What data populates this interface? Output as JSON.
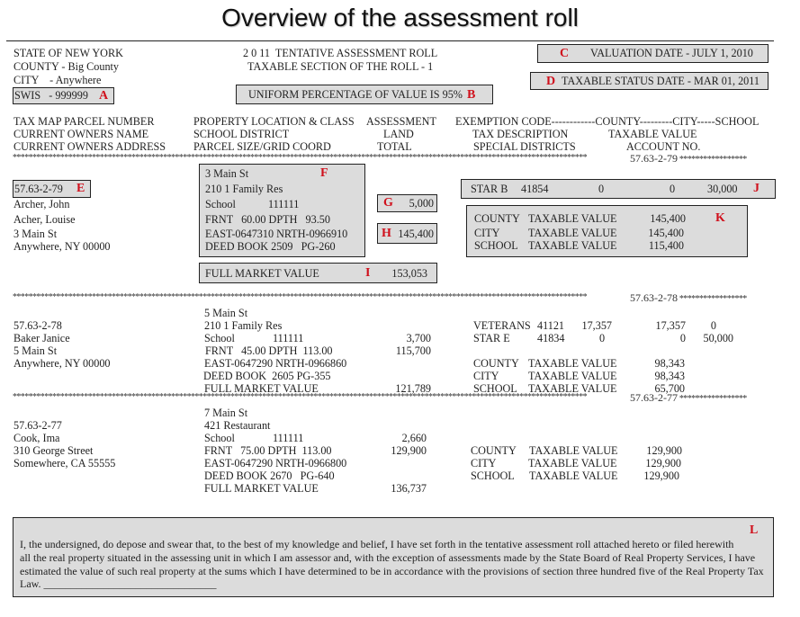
{
  "title": "Overview of the assessment roll",
  "header": {
    "state": "STATE OF NEW YORK",
    "county": "COUNTY - Big County",
    "city": "CITY    - Anywhere",
    "swis": "SWIS   - 999999",
    "roll_title": "2 0 11  TENTATIVE ASSESSMENT ROLL",
    "roll_section": "TAXABLE SECTION OF THE ROLL - 1",
    "uniform_percentage": "UNIFORM PERCENTAGE OF VALUE IS 95%",
    "valuation_date": "VALUATION DATE - JULY 1, 2010",
    "taxable_status_date": "TAXABLE STATUS DATE - MAR 01, 2011"
  },
  "labels": {
    "A": "A",
    "B": "B",
    "C": "C",
    "D": "D",
    "E": "E",
    "F": "F",
    "G": "G",
    "H": "H",
    "I": "I",
    "J": "J",
    "K": "K",
    "L": "L"
  },
  "columns": {
    "col1": [
      "TAX MAP PARCEL NUMBER",
      "CURRENT OWNERS NAME",
      "CURRENT OWNERS ADDRESS"
    ],
    "col2": [
      "PROPERTY LOCATION & CLASS",
      "SCHOOL DISTRICT",
      "PARCEL SIZE/GRID COORD"
    ],
    "col3": [
      "ASSESSMENT",
      "LAND",
      "TOTAL"
    ],
    "col4": [
      "EXEMPTION CODE------------COUNTY---------CITY-----SCHOOL",
      "TAX DESCRIPTION",
      "SPECIAL DISTRICTS"
    ],
    "col5": [
      "",
      "TAXABLE VALUE",
      "ACCOUNT NO."
    ]
  },
  "separators": {
    "stars_left": "*************************************************************************************************************************************************",
    "stars_right": "*****************"
  },
  "parcels": [
    {
      "parcel_number": "57.63-2-79",
      "owners": [
        "Archer, John",
        "Acher, Louise"
      ],
      "address": [
        "3 Main St",
        "Anywhere, NY 00000"
      ],
      "location": "3 Main St",
      "class": "210 1 Family Res",
      "school_label": "School",
      "school_code": "111111",
      "frontage": "FRNT   60.00 DPTH   93.50",
      "grid": "EAST-0647310 NRTH-0966910",
      "deed": "DEED BOOK 2509   PG-260",
      "full_market_label": "FULL MARKET VALUE",
      "land": "5,000",
      "total": "145,400",
      "full_market_value": "153,053",
      "exemptions": [
        {
          "name": "STAR B",
          "code": "41854",
          "county": "0",
          "city": "0",
          "school": "30,000"
        }
      ],
      "taxable": [
        {
          "jurisdiction": "COUNTY",
          "desc": "TAXABLE VALUE",
          "value": "145,400"
        },
        {
          "jurisdiction": "CITY",
          "desc": "TAXABLE VALUE",
          "value": "145,400"
        },
        {
          "jurisdiction": "SCHOOL",
          "desc": "TAXABLE VALUE",
          "value": "115,400"
        }
      ]
    },
    {
      "parcel_number": "57.63-2-78",
      "owners": [
        "Baker Janice"
      ],
      "address": [
        "5 Main St",
        "Anywhere, NY 00000"
      ],
      "location": "5 Main St",
      "class": "210 1 Family Res",
      "school_label": "School",
      "school_code": "111111",
      "frontage": "FRNT   45.00 DPTH  113.00",
      "grid": "EAST-0647290 NRTH-0966860",
      "deed": "DEED BOOK  2605 PG-355",
      "full_market_label": "FULL MARKET VALUE",
      "land": "3,700",
      "total": "115,700",
      "full_market_value": "121,789",
      "exemptions": [
        {
          "name": "VETERANS",
          "code": "41121",
          "county": "17,357",
          "city": "17,357",
          "school": "0"
        },
        {
          "name": "STAR E",
          "code": "41834",
          "county": "0",
          "city": "0",
          "school": "50,000"
        }
      ],
      "taxable": [
        {
          "jurisdiction": "COUNTY",
          "desc": "TAXABLE VALUE",
          "value": "98,343"
        },
        {
          "jurisdiction": "CITY",
          "desc": "TAXABLE VALUE",
          "value": "98,343"
        },
        {
          "jurisdiction": "SCHOOL",
          "desc": "TAXABLE VALUE",
          "value": "65,700"
        }
      ]
    },
    {
      "parcel_number": "57.63-2-77",
      "owners": [
        "Cook, Ima"
      ],
      "address": [
        "310 George Street",
        "Somewhere, CA 55555"
      ],
      "location": "7 Main St",
      "class": "421 Restaurant",
      "school_label": "School",
      "school_code": "111111",
      "frontage": "FRNT   75.00 DPTH  113.00",
      "grid": "EAST-0647290 NRTH-0966800",
      "deed": "DEED BOOK 2670   PG-640",
      "full_market_label": "FULL MARKET VALUE",
      "land": "2,660",
      "total": "129,900",
      "full_market_value": "136,737",
      "exemptions": [],
      "taxable": [
        {
          "jurisdiction": "COUNTY",
          "desc": "TAXABLE VALUE",
          "value": "129,900"
        },
        {
          "jurisdiction": "CITY",
          "desc": "TAXABLE VALUE",
          "value": "129,900"
        },
        {
          "jurisdiction": "SCHOOL",
          "desc": "TAXABLE VALUE",
          "value": "129,900"
        }
      ]
    }
  ],
  "attestation": {
    "lines": [
      "I, the undersigned, do depose and swear that, to the best of my knowledge and belief, I have set forth in the tentative assessment roll attached hereto or filed herewith",
      "all the real property situated in the assessing unit in which I am assessor and, with the exception of assessments made by the State Board of Real Property Services, I have",
      "estimated the value of such real property at the sums which I have determined to be in accordance with the provisions of section three hundred five of the Real Property Tax",
      "Law."
    ],
    "signature_line": "________________________________"
  }
}
